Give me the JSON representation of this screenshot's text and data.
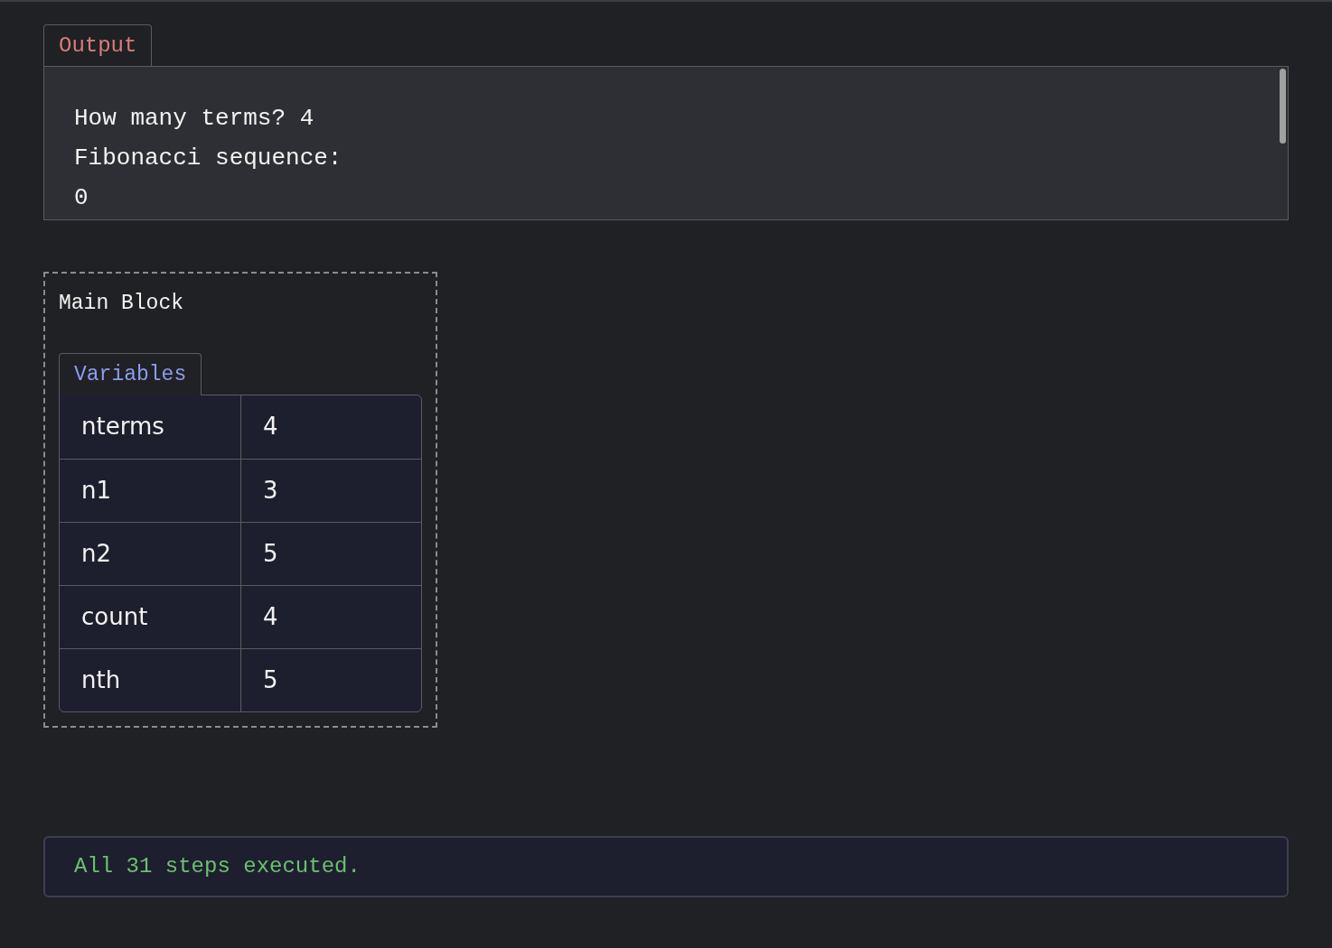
{
  "output": {
    "tab": "Output",
    "lines": [
      "How many terms? 4",
      "Fibonacci sequence:",
      "0"
    ]
  },
  "block": {
    "title": "Main Block",
    "tab": "Variables",
    "rows": [
      {
        "name": "nterms",
        "value": "4"
      },
      {
        "name": "n1",
        "value": "3"
      },
      {
        "name": "n2",
        "value": "5"
      },
      {
        "name": "count",
        "value": "4"
      },
      {
        "name": "nth",
        "value": "5"
      }
    ]
  },
  "status": "All 31 steps executed."
}
